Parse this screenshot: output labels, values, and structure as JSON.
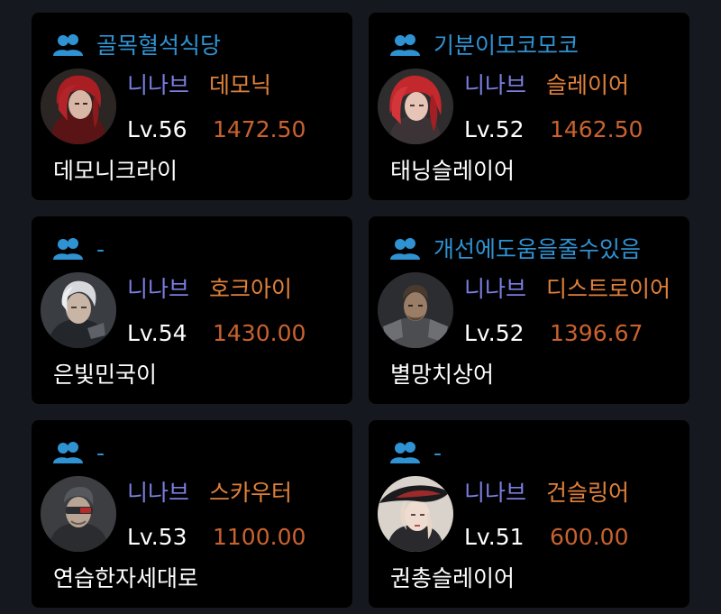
{
  "cards": [
    {
      "guild": "골목혈석식당",
      "server": "니나브",
      "class": "데모닉",
      "level": "Lv.56",
      "item_level": "1472.50",
      "name": "데모니크라이",
      "portrait": "red-hair-woman-portrait"
    },
    {
      "guild": "기분이모코모코",
      "server": "니나브",
      "class": "슬레이어",
      "level": "Lv.52",
      "item_level": "1462.50",
      "name": "태닝슬레이어",
      "portrait": "red-hair-woman-portrait"
    },
    {
      "guild": "-",
      "server": "니나브",
      "class": "호크아이",
      "level": "Lv.54",
      "item_level": "1430.00",
      "name": "은빛민국이",
      "portrait": "silver-hair-man-portrait"
    },
    {
      "guild": "개선에도움을줄수있음",
      "server": "니나브",
      "class": "디스트로이어",
      "level": "Lv.52",
      "item_level": "1396.67",
      "name": "별망치상어",
      "portrait": "armored-man-portrait"
    },
    {
      "guild": "-",
      "server": "니나브",
      "class": "스카우터",
      "level": "Lv.53",
      "item_level": "1100.00",
      "name": "연습한자세대로",
      "portrait": "visor-man-portrait"
    },
    {
      "guild": "-",
      "server": "니나브",
      "class": "건슬링어",
      "level": "Lv.51",
      "item_level": "600.00",
      "name": "권총슬레이어",
      "portrait": "hat-woman-portrait"
    }
  ],
  "colors": {
    "background": "#15181e",
    "card": "#000000",
    "guild": "#2f93d3",
    "server": "#7b7fe0",
    "class": "#e0813a",
    "item_level": "#c9622f",
    "text": "#ffffff"
  }
}
